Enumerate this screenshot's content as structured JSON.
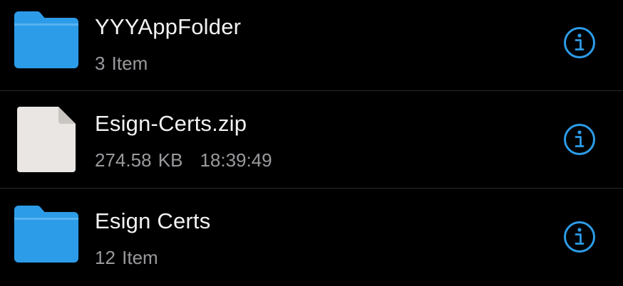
{
  "files": [
    {
      "name": "YYYAppFolder",
      "kind": "folder",
      "detail": "3 Item"
    },
    {
      "name": "Esign-Certs.zip",
      "kind": "file",
      "size": "274.58 KB",
      "time": "18:39:49"
    },
    {
      "name": "Esign Certs",
      "kind": "folder",
      "detail": "12 Item"
    }
  ],
  "icons": {
    "folder": "folder-icon",
    "file": "document-icon",
    "info": "info-icon"
  },
  "colors": {
    "background": "#000000",
    "accent": "#2d9ce8",
    "folder": "#2d9ce8",
    "file": "#e9e6e3",
    "primary_text": "#f2f2f2",
    "secondary_text": "#9a9a9e",
    "separator": "#2a2a2c"
  }
}
